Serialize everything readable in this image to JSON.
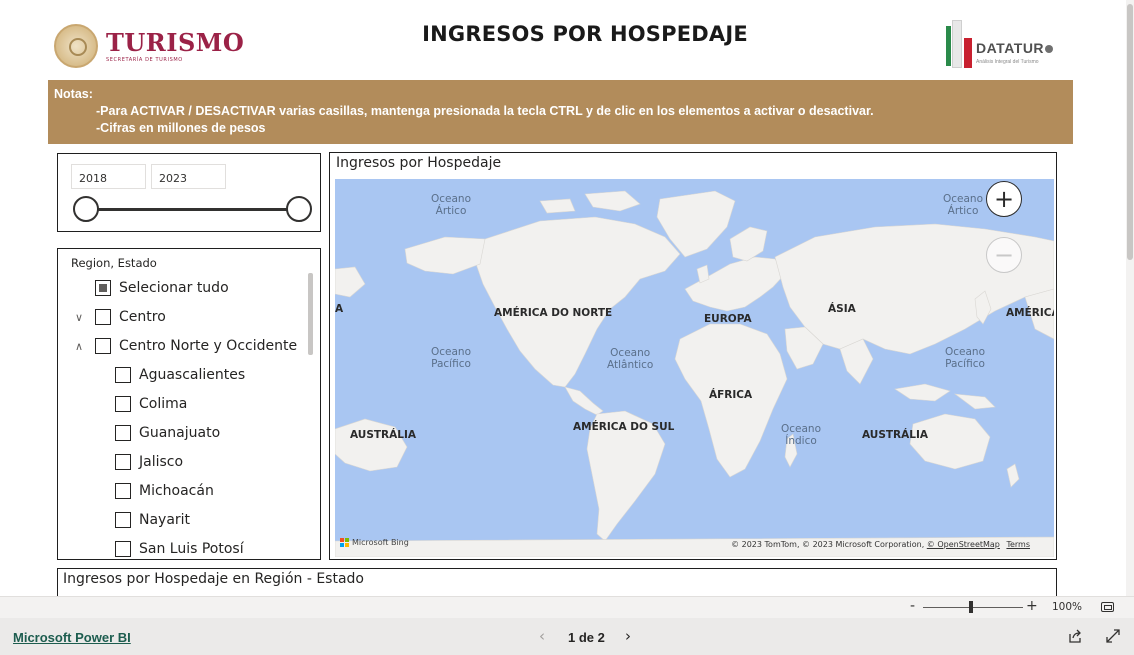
{
  "header": {
    "brand_main": "TURISMO",
    "brand_sub": "SECRETARÍA DE TURISMO",
    "title": "INGRESOS POR HOSPEDAJE",
    "datatur_main": "DATATUR",
    "datatur_sub": "Análisis Integral del Turismo"
  },
  "notes": {
    "title": "Notas:",
    "lines": [
      "-Para ACTIVAR / DESACTIVAR varias casillas, mantenga presionada la tecla CTRL y de clic en los elementos a activar o desactivar.",
      "-Cifras en millones de pesos"
    ]
  },
  "year_slicer": {
    "from": "2018",
    "to": "2023"
  },
  "region_slicer": {
    "header": "Region, Estado",
    "select_all": "Selecionar tudo",
    "groups": [
      {
        "label": "Centro",
        "state": "collapsed"
      },
      {
        "label": "Centro Norte y Occidente",
        "state": "expanded"
      }
    ],
    "states": [
      "Aguascalientes",
      "Colima",
      "Guanajuato",
      "Jalisco",
      "Michoacán",
      "Nayarit",
      "San Luis Potosí"
    ]
  },
  "map": {
    "title": "Ingresos por Hospedaje",
    "ocean_labels": [
      "Oceano Ártico",
      "Oceano Ártico",
      "Oceano Pacífico",
      "Oceano Atlântico",
      "Oceano Pacífico",
      "Oceano Índico"
    ],
    "continent_labels": [
      "AMÉRICA DO NORTE",
      "EUROPA",
      "ÁSIA",
      "AMÉRICA",
      "A",
      "ÁFRICA",
      "AMÉRICA DO SUL",
      "AUSTRÁLIA",
      "AUSTRÁLIA"
    ],
    "provider": "Microsoft Bing",
    "attribution": "© 2023 TomTom, © 2023 Microsoft Corporation,",
    "attribution_osm": "© OpenStreetMap",
    "attribution_terms": "Terms"
  },
  "table": {
    "title": "Ingresos por Hospedaje en Región - Estado"
  },
  "zoom": {
    "percent": "100%",
    "level": 1.0
  },
  "footer": {
    "powerbi_link": "Microsoft Power BI",
    "page_indicator": "1 de 2"
  },
  "colors": {
    "brand": "#9b2247",
    "notes_bg": "#b28c5b",
    "ocean": "#a9c6f2",
    "land": "#f2f1ef"
  }
}
